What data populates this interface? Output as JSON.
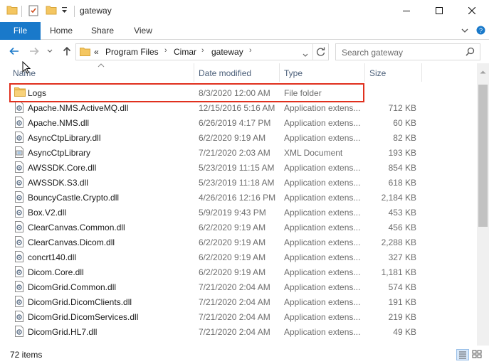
{
  "window": {
    "title": "gateway",
    "controls": [
      "minimize-icon",
      "maximize-icon",
      "close-icon"
    ]
  },
  "ribbon": {
    "tabs": [
      "File",
      "Home",
      "Share",
      "View"
    ]
  },
  "address": {
    "overflow": "«",
    "breadcrumbs": [
      "Program Files",
      "Cimar",
      "gateway"
    ]
  },
  "search": {
    "placeholder": "Search gateway"
  },
  "columns": [
    "Name",
    "Date modified",
    "Type",
    "Size"
  ],
  "files": [
    {
      "name": "Logs",
      "date": "8/3/2020 12:00 AM",
      "type": "File folder",
      "size": "",
      "icon": "folder-icon"
    },
    {
      "name": "Apache.NMS.ActiveMQ.dll",
      "date": "12/15/2016 5:16 AM",
      "type": "Application extens...",
      "size": "712 KB",
      "icon": "dll-icon"
    },
    {
      "name": "Apache.NMS.dll",
      "date": "6/26/2019 4:17 PM",
      "type": "Application extens...",
      "size": "60 KB",
      "icon": "dll-icon"
    },
    {
      "name": "AsyncCtpLibrary.dll",
      "date": "6/2/2020 9:19 AM",
      "type": "Application extens...",
      "size": "82 KB",
      "icon": "dll-icon"
    },
    {
      "name": "AsyncCtpLibrary",
      "date": "7/21/2020 2:03 AM",
      "type": "XML Document",
      "size": "193 KB",
      "icon": "xml-icon"
    },
    {
      "name": "AWSSDK.Core.dll",
      "date": "5/23/2019 11:15 AM",
      "type": "Application extens...",
      "size": "854 KB",
      "icon": "dll-icon"
    },
    {
      "name": "AWSSDK.S3.dll",
      "date": "5/23/2019 11:18 AM",
      "type": "Application extens...",
      "size": "618 KB",
      "icon": "dll-icon"
    },
    {
      "name": "BouncyCastle.Crypto.dll",
      "date": "4/26/2016 12:16 PM",
      "type": "Application extens...",
      "size": "2,184 KB",
      "icon": "dll-icon"
    },
    {
      "name": "Box.V2.dll",
      "date": "5/9/2019 9:43 PM",
      "type": "Application extens...",
      "size": "453 KB",
      "icon": "dll-icon"
    },
    {
      "name": "ClearCanvas.Common.dll",
      "date": "6/2/2020 9:19 AM",
      "type": "Application extens...",
      "size": "456 KB",
      "icon": "dll-icon"
    },
    {
      "name": "ClearCanvas.Dicom.dll",
      "date": "6/2/2020 9:19 AM",
      "type": "Application extens...",
      "size": "2,288 KB",
      "icon": "dll-icon"
    },
    {
      "name": "concrt140.dll",
      "date": "6/2/2020 9:19 AM",
      "type": "Application extens...",
      "size": "327 KB",
      "icon": "dll-icon"
    },
    {
      "name": "Dicom.Core.dll",
      "date": "6/2/2020 9:19 AM",
      "type": "Application extens...",
      "size": "1,181 KB",
      "icon": "dll-icon"
    },
    {
      "name": "DicomGrid.Common.dll",
      "date": "7/21/2020 2:04 AM",
      "type": "Application extens...",
      "size": "574 KB",
      "icon": "dll-icon"
    },
    {
      "name": "DicomGrid.DicomClients.dll",
      "date": "7/21/2020 2:04 AM",
      "type": "Application extens...",
      "size": "191 KB",
      "icon": "dll-icon"
    },
    {
      "name": "DicomGrid.DicomServices.dll",
      "date": "7/21/2020 2:04 AM",
      "type": "Application extens...",
      "size": "219 KB",
      "icon": "dll-icon"
    },
    {
      "name": "DicomGrid.HL7.dll",
      "date": "7/21/2020 2:04 AM",
      "type": "Application extens...",
      "size": "49 KB",
      "icon": "dll-icon"
    }
  ],
  "status": {
    "count": "72 items"
  },
  "colors": {
    "accent": "#1979ca",
    "highlight_border": "#e0301e",
    "folder": "#e8b84a"
  }
}
